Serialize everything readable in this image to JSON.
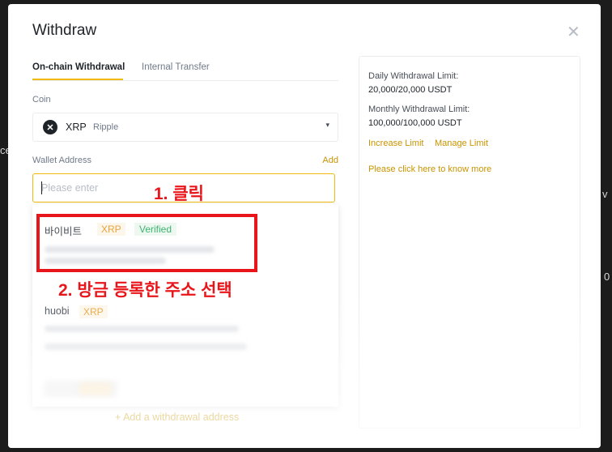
{
  "modal": {
    "title": "Withdraw",
    "close_icon": "close-icon"
  },
  "tabs": [
    {
      "label": "On-chain Withdrawal",
      "active": true
    },
    {
      "label": "Internal Transfer",
      "active": false
    }
  ],
  "coin": {
    "label": "Coin",
    "symbol": "XRP",
    "name": "Ripple",
    "icon_glyph": "✕",
    "icon": "xrp-logo-icon",
    "caret": "▾"
  },
  "wallet": {
    "label": "Wallet Address",
    "add_label": "Add",
    "placeholder": "Please enter"
  },
  "address_list": [
    {
      "name": "바이비트",
      "coin": "XRP",
      "verified_label": "Verified"
    },
    {
      "name": "huobi",
      "coin": "XRP"
    }
  ],
  "add_withdrawal_address": "+ Add a withdrawal address",
  "limits": {
    "daily_label": "Daily Withdrawal Limit:",
    "daily_value": "20,000/20,000 USDT",
    "monthly_label": "Monthly Withdrawal Limit:",
    "monthly_value": "100,000/100,000 USDT",
    "increase_link": "Increase Limit",
    "manage_link": "Manage Limit",
    "know_more_link": "Please click here to know more"
  },
  "annotations": {
    "step1": "1. 클릭",
    "step2": "2. 방금 등록한 주소 선택"
  },
  "colors": {
    "accent": "#f0b90b",
    "link": "#c99400",
    "annotation": "#e8161b",
    "verified": "#3cb371"
  }
}
